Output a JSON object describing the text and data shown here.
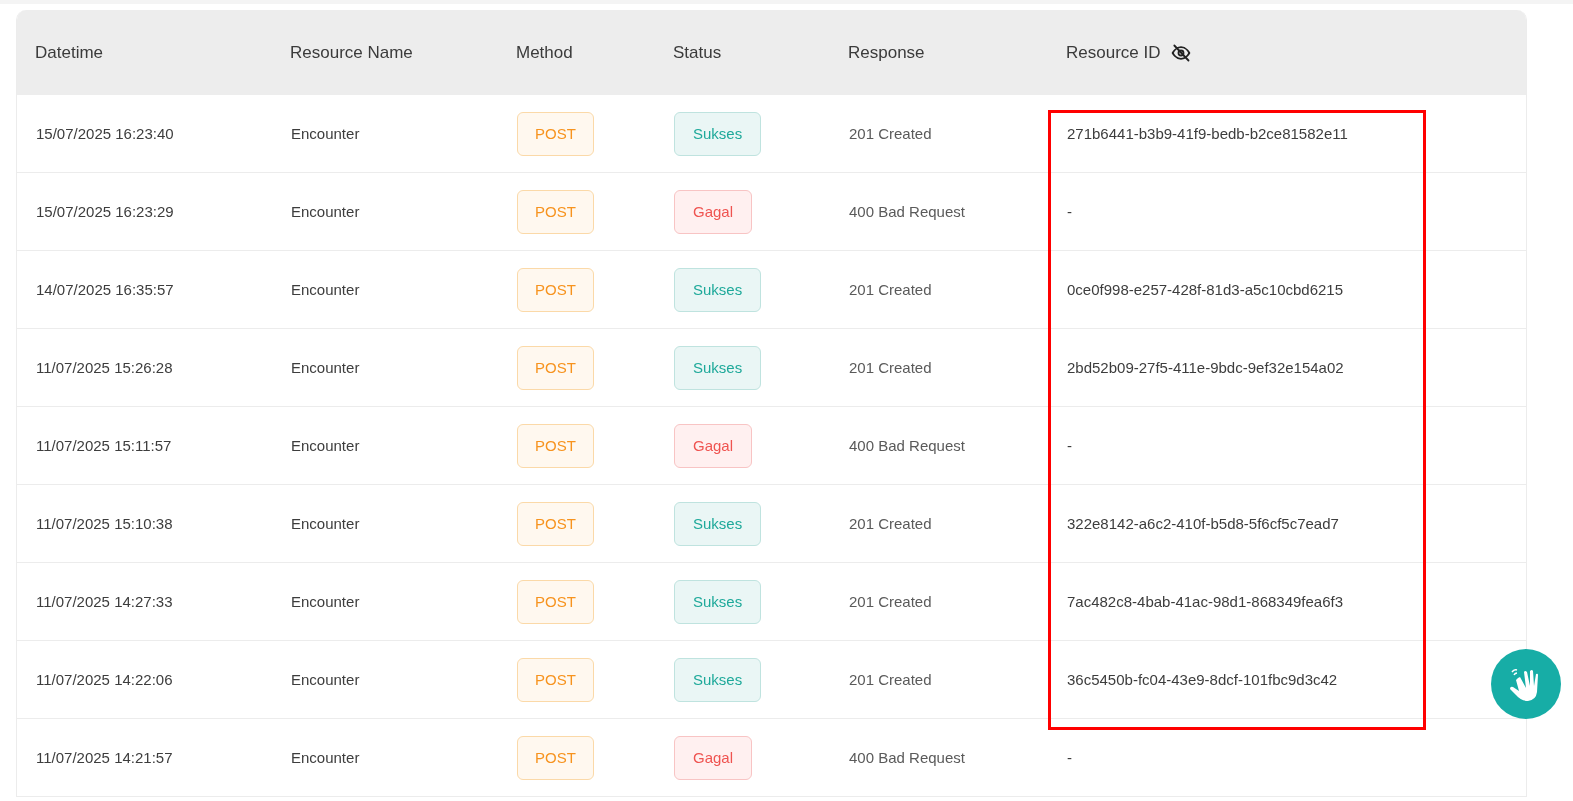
{
  "table": {
    "columns": [
      "Datetime",
      "Resource Name",
      "Method",
      "Status",
      "Response",
      "Resource ID"
    ],
    "rows": [
      {
        "datetime": "15/07/2025 16:23:40",
        "resource_name": "Encounter",
        "method": "POST",
        "status": {
          "label": "Sukses",
          "kind": "success"
        },
        "response": "201 Created",
        "resource_id": "271b6441-b3b9-41f9-bedb-b2ce81582e11"
      },
      {
        "datetime": "15/07/2025 16:23:29",
        "resource_name": "Encounter",
        "method": "POST",
        "status": {
          "label": "Gagal",
          "kind": "failed"
        },
        "response": "400 Bad Request",
        "resource_id": "-"
      },
      {
        "datetime": "14/07/2025 16:35:57",
        "resource_name": "Encounter",
        "method": "POST",
        "status": {
          "label": "Sukses",
          "kind": "success"
        },
        "response": "201 Created",
        "resource_id": "0ce0f998-e257-428f-81d3-a5c10cbd6215"
      },
      {
        "datetime": "11/07/2025 15:26:28",
        "resource_name": "Encounter",
        "method": "POST",
        "status": {
          "label": "Sukses",
          "kind": "success"
        },
        "response": "201 Created",
        "resource_id": "2bd52b09-27f5-411e-9bdc-9ef32e154a02"
      },
      {
        "datetime": "11/07/2025 15:11:57",
        "resource_name": "Encounter",
        "method": "POST",
        "status": {
          "label": "Gagal",
          "kind": "failed"
        },
        "response": "400 Bad Request",
        "resource_id": "-"
      },
      {
        "datetime": "11/07/2025 15:10:38",
        "resource_name": "Encounter",
        "method": "POST",
        "status": {
          "label": "Sukses",
          "kind": "success"
        },
        "response": "201 Created",
        "resource_id": "322e8142-a6c2-410f-b5d8-5f6cf5c7ead7"
      },
      {
        "datetime": "11/07/2025 14:27:33",
        "resource_name": "Encounter",
        "method": "POST",
        "status": {
          "label": "Sukses",
          "kind": "success"
        },
        "response": "201 Created",
        "resource_id": "7ac482c8-4bab-41ac-98d1-868349fea6f3"
      },
      {
        "datetime": "11/07/2025 14:22:06",
        "resource_name": "Encounter",
        "method": "POST",
        "status": {
          "label": "Sukses",
          "kind": "success"
        },
        "response": "201 Created",
        "resource_id": "36c5450b-fc04-43e9-8dcf-101fbc9d3c42"
      },
      {
        "datetime": "11/07/2025 14:21:57",
        "resource_name": "Encounter",
        "method": "POST",
        "status": {
          "label": "Gagal",
          "kind": "failed"
        },
        "response": "400 Bad Request",
        "resource_id": "-"
      }
    ]
  }
}
